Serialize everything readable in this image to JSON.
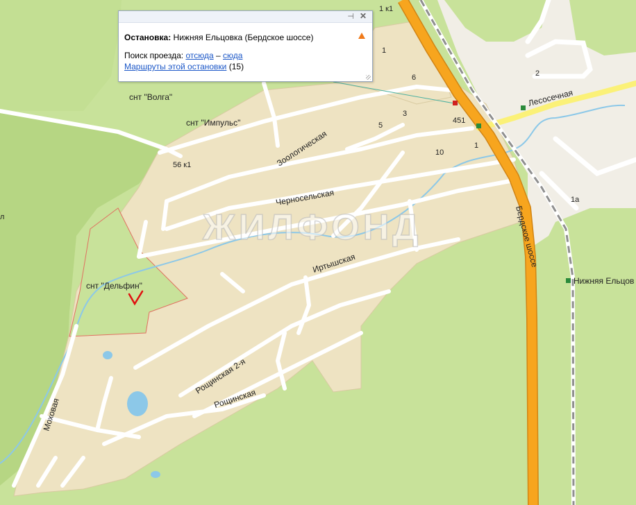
{
  "popup": {
    "title_label": "Остановка:",
    "title_value": "Нижняя Ельцовка (Бердское шоссе)",
    "route_search_label": "Поиск проезда:",
    "link_from": "отсюда",
    "dash": "–",
    "link_to": "сюда",
    "routes_link": "Маршруты этой остановки",
    "routes_count": "(15)"
  },
  "map": {
    "watermark": "ЖИЛФОНД",
    "streets": {
      "berdskoe": "Бердское шоссе",
      "lesosechnaya": "Лесосечная",
      "zoologicheskaya": "Зоологическая",
      "chernoselskaya": "Черносельская",
      "irtyshskaya": "Иртышская",
      "roshchinskaya2": "Рощинская 2-я",
      "roshchinskaya": "Рощинская",
      "mokhovaya": "Моховая"
    },
    "areas": {
      "volga": "снт \"Волга\"",
      "impuls": "снт \"Импульс\"",
      "delfin": "снт \"Дельфин\"",
      "stop_label": "Нижняя Ельцов"
    },
    "house_numbers": {
      "n1k1_top": "1 к1",
      "n1": "1",
      "n2": "2",
      "n3": "3",
      "n5": "5",
      "n6": "6",
      "n10": "10",
      "n451": "451",
      "n1_road": "1",
      "n56k1": "56 к1",
      "n1a": "1а",
      "n_left": "л"
    },
    "colors": {
      "forest": "#c8e29a",
      "dark_green": "#b6d683",
      "settlement": "#eee3c2",
      "highway": "#f7a51e",
      "road": "#ffffff",
      "water": "#8cc8e8",
      "yellow_road": "#fbf178",
      "rail": "#8f8f8f",
      "link": "#1a56c7",
      "warn": "#f07a1a",
      "marker": "#e01010"
    }
  }
}
